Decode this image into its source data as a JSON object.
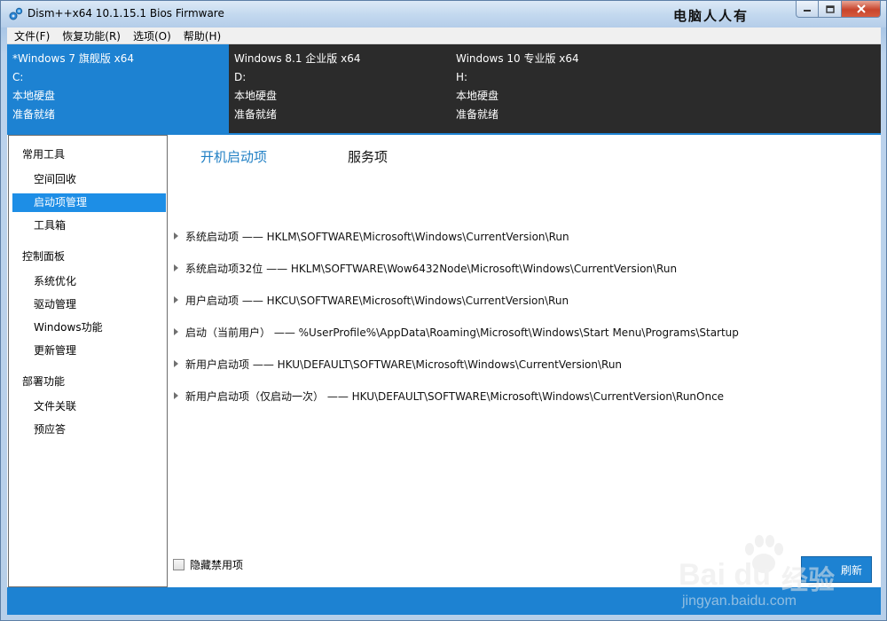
{
  "window": {
    "title": "Dism++x64 10.1.15.1 Bios Firmware",
    "corner_text": "电脑人人有"
  },
  "menu": [
    {
      "label": "文件(F)"
    },
    {
      "label": "恢复功能(R)"
    },
    {
      "label": "选项(O)"
    },
    {
      "label": "帮助(H)"
    }
  ],
  "systems": [
    {
      "name": "*Windows 7 旗舰版 x64",
      "drive": "C:",
      "type": "本地硬盘",
      "status": "准备就绪",
      "active": true
    },
    {
      "name": "Windows 8.1 企业版 x64",
      "drive": "D:",
      "type": "本地硬盘",
      "status": "准备就绪",
      "active": false
    },
    {
      "name": "Windows 10 专业版 x64",
      "drive": "H:",
      "type": "本地硬盘",
      "status": "准备就绪",
      "active": false
    }
  ],
  "sidebar": {
    "groups": [
      {
        "label": "常用工具",
        "items": [
          "空间回收",
          "启动项管理",
          "工具箱"
        ]
      },
      {
        "label": "控制面板",
        "items": [
          "系统优化",
          "驱动管理",
          "Windows功能",
          "更新管理"
        ]
      },
      {
        "label": "部署功能",
        "items": [
          "文件关联",
          "预应答"
        ]
      }
    ],
    "selected": "启动项管理"
  },
  "tabs": [
    {
      "label": "开机启动项",
      "active": true
    },
    {
      "label": "服务项",
      "active": false
    }
  ],
  "startup_entries": [
    "系统启动项 —— HKLM\\SOFTWARE\\Microsoft\\Windows\\CurrentVersion\\Run",
    "系统启动项32位 —— HKLM\\SOFTWARE\\Wow6432Node\\Microsoft\\Windows\\CurrentVersion\\Run",
    "用户启动项 —— HKCU\\SOFTWARE\\Microsoft\\Windows\\CurrentVersion\\Run",
    "启动（当前用户） —— %UserProfile%\\AppData\\Roaming\\Microsoft\\Windows\\Start Menu\\Programs\\Startup",
    "新用户启动项 —— HKU\\DEFAULT\\SOFTWARE\\Microsoft\\Windows\\CurrentVersion\\Run",
    "新用户启动项（仅启动一次） —— HKU\\DEFAULT\\SOFTWARE\\Microsoft\\Windows\\CurrentVersion\\RunOnce"
  ],
  "options": {
    "hide_disabled_label": "隐藏禁用项",
    "refresh_label": "刷新"
  },
  "watermark": {
    "brand": "Bai du",
    "jingyan": "经验",
    "url": "jingyan.baidu.com"
  },
  "colors": {
    "accent": "#1d82d2",
    "selected_nav": "#1d8ee6",
    "system_bar": "#2b2b2b",
    "active_tab": "#1f7fc4"
  }
}
